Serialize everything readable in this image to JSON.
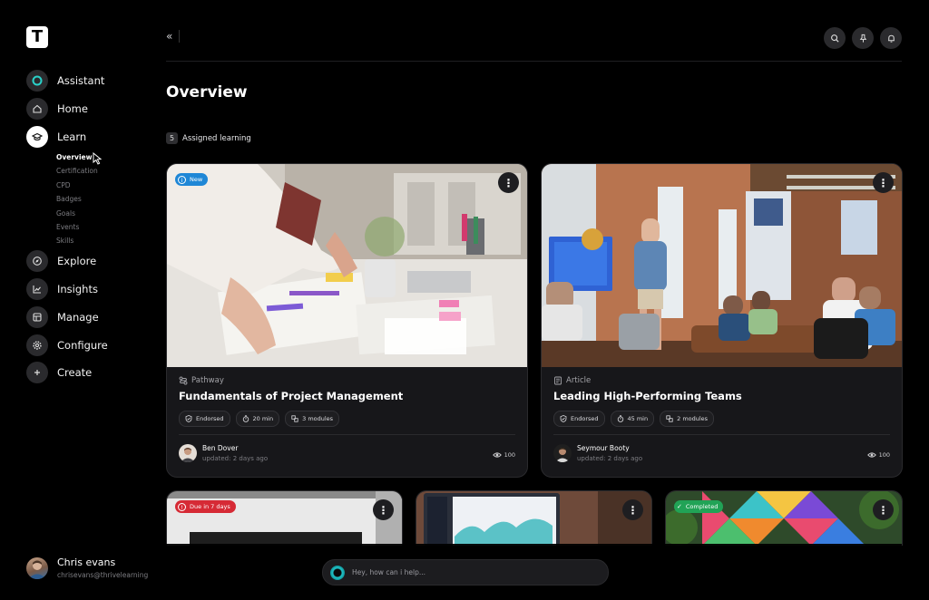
{
  "app": {
    "logo_letter": "T"
  },
  "sidebar": {
    "nav": [
      {
        "label": "Assistant",
        "icon": "assistant-orb-icon"
      },
      {
        "label": "Home",
        "icon": "home-icon"
      },
      {
        "label": "Learn",
        "icon": "graduation-cap-icon"
      },
      {
        "label": "Explore",
        "icon": "compass-icon"
      },
      {
        "label": "Insights",
        "icon": "chart-line-icon"
      },
      {
        "label": "Manage",
        "icon": "grid-icon"
      },
      {
        "label": "Configure",
        "icon": "gear-icon"
      },
      {
        "label": "Create",
        "icon": "plus-icon"
      }
    ],
    "learn_sub": [
      "Overview",
      "Certification",
      "CPD",
      "Badges",
      "Goals",
      "Events",
      "Skills"
    ],
    "active_sub": "Overview"
  },
  "user": {
    "name": "Chris evans",
    "email": "chrisevans@thrivelearning"
  },
  "header": {
    "collapse_glyph": "«"
  },
  "page": {
    "title": "Overview"
  },
  "section": {
    "count": "5",
    "label": "Assigned learning"
  },
  "cards": [
    {
      "badge": "New",
      "type": "Pathway",
      "title": "Fundamentals of Project Management",
      "chips": [
        "Endorsed",
        "20 min",
        "3 modules"
      ],
      "author": "Ben Dover",
      "updated": "updated: 2 days ago",
      "views": "100"
    },
    {
      "badge": "",
      "type": "Article",
      "title": "Leading High-Performing Teams",
      "chips": [
        "Endorsed",
        "45 min",
        "2 modules"
      ],
      "author": "Seymour Booty",
      "updated": "updated: 2 days ago",
      "views": "100"
    },
    {
      "badge": "Due in 7 days"
    },
    {
      "badge": ""
    },
    {
      "badge": "Completed"
    }
  ],
  "assistant": {
    "placeholder": "Hey, how can i help..."
  },
  "colors": {
    "background": "#000000",
    "card": "#17171a",
    "badge_new": "#1f87d6",
    "badge_due": "#d62a35",
    "badge_completed": "#21a356",
    "assistant_accent": "#20c4c9"
  }
}
